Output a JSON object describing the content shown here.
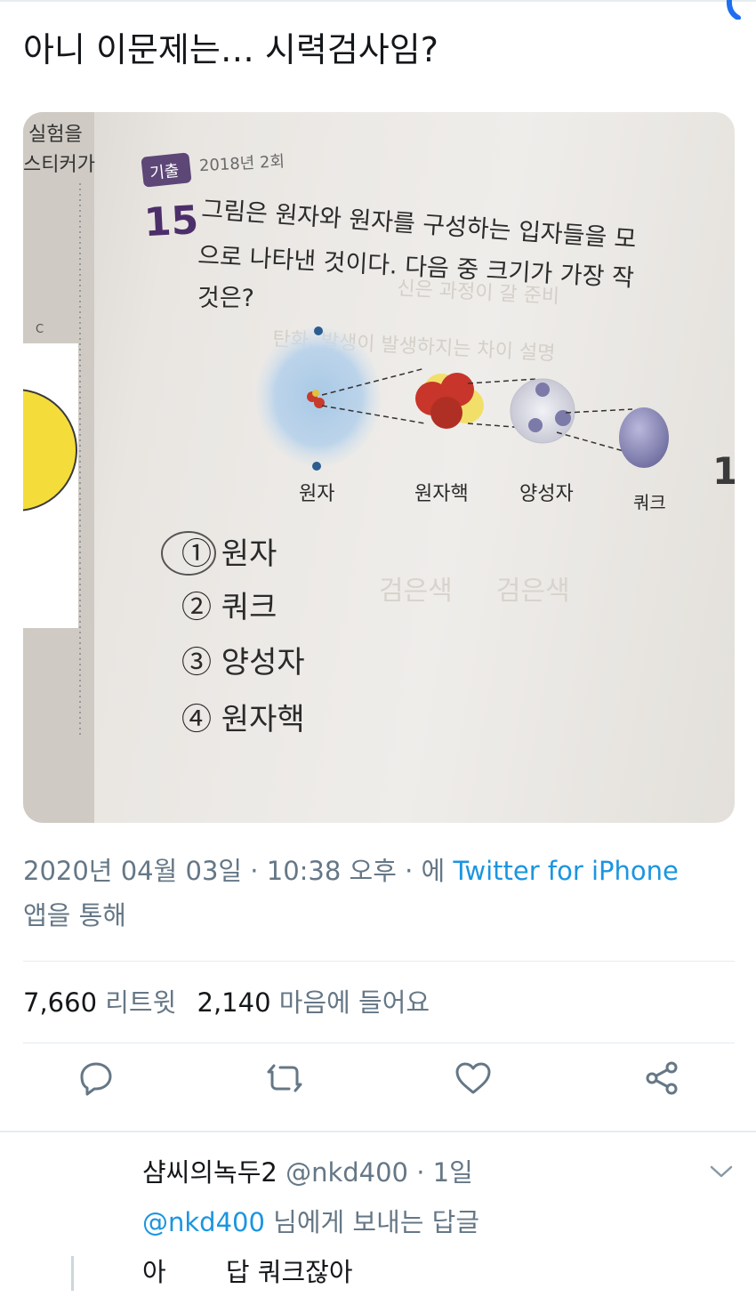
{
  "tweet": {
    "text": "아니 이문제는… 시력검사임?",
    "timestamp": "2020년 04월 03일 · 10:38 오후 · 에",
    "via_app": "Twitter for iPhone",
    "via_suffix": "앱을 통해",
    "retweets_count": "7,660",
    "retweets_label": "리트윗",
    "likes_count": "2,140",
    "likes_label": "마음에 들어요"
  },
  "photo": {
    "margin_words": [
      "실험을",
      "스티커가"
    ],
    "badge": "기출",
    "year": "2018년 2회",
    "question_number": "15",
    "question_line1": "그림은 원자와 원자를 구성하는 입자들을 모",
    "question_line2": "으로 나타낸 것이다. 다음 중 크기가 가장 작",
    "question_line3": "것은?",
    "labels": [
      "원자",
      "원자핵",
      "양성자",
      "쿼크"
    ],
    "choices": [
      "① 원자",
      "② 쿼크",
      "③ 양성자",
      "④ 원자핵"
    ],
    "side_number": "1"
  },
  "actions": {
    "reply_icon": "reply-icon",
    "retweet_icon": "retweet-icon",
    "like_icon": "heart-icon",
    "share_icon": "share-icon"
  },
  "reply": {
    "name": "샴씨의녹두2",
    "handle": "@nkd400",
    "time": "· 1일",
    "mention": "@nkd400",
    "mention_suffix": "님에게 보내는 답글",
    "text": "아 　　답 쿼크잖아"
  },
  "colors": {
    "link": "#1b95e0",
    "secondary_text": "#657786",
    "primary_text": "#14171a",
    "divider": "#e6ecf0"
  }
}
